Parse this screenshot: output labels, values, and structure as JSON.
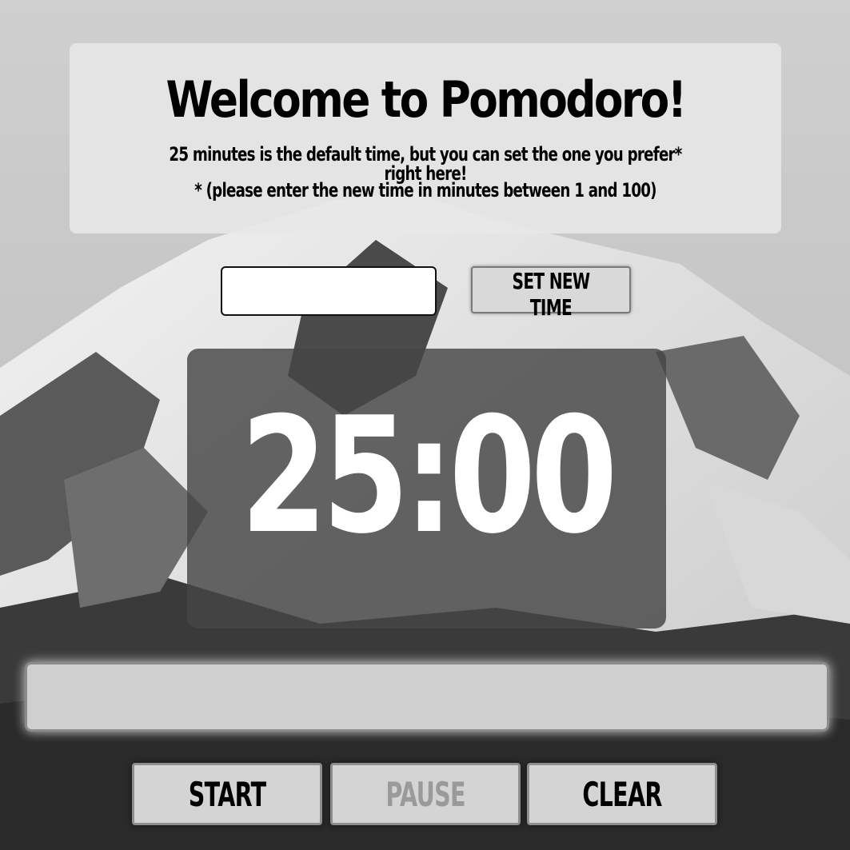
{
  "header": {
    "title": "Welcome to Pomodoro!",
    "line1": "25 minutes is the default time, but you can set the one you prefer* right here!",
    "line2": "* (please enter the new time in minutes between 1 and 100)"
  },
  "time_setter": {
    "input_value": "",
    "input_placeholder": "",
    "button_label": "SET NEW TIME"
  },
  "timer": {
    "display": "25:00"
  },
  "progress": {
    "fraction": 0
  },
  "controls": {
    "start_label": "START",
    "pause_label": "PAUSE",
    "clear_label": "CLEAR",
    "pause_disabled": true
  },
  "colors": {
    "card": "#e8e8e8",
    "timer_panel": "#464646",
    "timer_text": "#ffffff",
    "disabled_text": "#9a9a9a"
  }
}
